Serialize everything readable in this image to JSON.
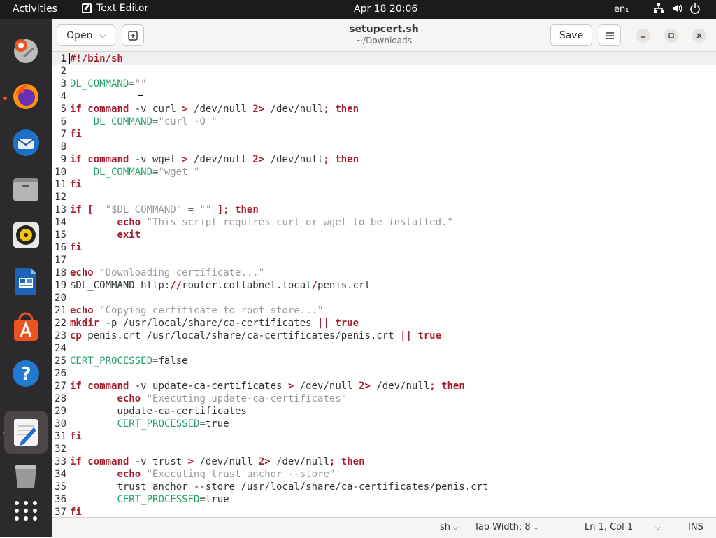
{
  "topbar": {
    "activities": "Activities",
    "app_name": "Text Editor",
    "clock": "Apr 18  20:06",
    "language": "en₁"
  },
  "dock": {
    "items": [
      "ubuntu-dock",
      "firefox",
      "thunderbird",
      "files",
      "rhythmbox",
      "libreoffice-writer",
      "app-center",
      "help",
      "text-editor",
      "trash",
      "show-apps"
    ]
  },
  "header": {
    "open_label": "Open",
    "filename": "setupcert.sh",
    "path": "~/Downloads",
    "save_label": "Save"
  },
  "editor": {
    "lines": [
      [
        {
          "t": "#!/bin/sh",
          "c": "kw"
        }
      ],
      [],
      [
        {
          "t": "DL_COMMAND",
          "c": "var"
        },
        {
          "t": "=",
          "c": ""
        },
        {
          "t": "\"\"",
          "c": "str"
        }
      ],
      [],
      [
        {
          "t": "if",
          "c": "kw"
        },
        {
          "t": " ",
          "c": ""
        },
        {
          "t": "command",
          "c": "kw"
        },
        {
          "t": " -v curl ",
          "c": ""
        },
        {
          "t": ">",
          "c": "kw"
        },
        {
          "t": " /dev/null ",
          "c": ""
        },
        {
          "t": "2>",
          "c": "kw"
        },
        {
          "t": " /dev/null",
          "c": ""
        },
        {
          "t": ";",
          "c": "kw"
        },
        {
          "t": " ",
          "c": ""
        },
        {
          "t": "then",
          "c": "kw"
        }
      ],
      [
        {
          "t": "    ",
          "c": ""
        },
        {
          "t": "DL_COMMAND",
          "c": "var"
        },
        {
          "t": "=",
          "c": ""
        },
        {
          "t": "\"curl -O \"",
          "c": "str"
        }
      ],
      [
        {
          "t": "fi",
          "c": "kw"
        }
      ],
      [],
      [
        {
          "t": "if",
          "c": "kw"
        },
        {
          "t": " ",
          "c": ""
        },
        {
          "t": "command",
          "c": "kw"
        },
        {
          "t": " -v wget ",
          "c": ""
        },
        {
          "t": ">",
          "c": "kw"
        },
        {
          "t": " /dev/null ",
          "c": ""
        },
        {
          "t": "2>",
          "c": "kw"
        },
        {
          "t": " /dev/null",
          "c": ""
        },
        {
          "t": ";",
          "c": "kw"
        },
        {
          "t": " ",
          "c": ""
        },
        {
          "t": "then",
          "c": "kw"
        }
      ],
      [
        {
          "t": "    ",
          "c": ""
        },
        {
          "t": "DL_COMMAND",
          "c": "var"
        },
        {
          "t": "=",
          "c": ""
        },
        {
          "t": "\"wget \"",
          "c": "str"
        }
      ],
      [
        {
          "t": "fi",
          "c": "kw"
        }
      ],
      [],
      [
        {
          "t": "if",
          "c": "kw"
        },
        {
          "t": " ",
          "c": ""
        },
        {
          "t": "[",
          "c": "kw"
        },
        {
          "t": "  ",
          "c": ""
        },
        {
          "t": "\"$DL_COMMAND\"",
          "c": "str"
        },
        {
          "t": " = ",
          "c": ""
        },
        {
          "t": "\"\"",
          "c": "str"
        },
        {
          "t": " ",
          "c": ""
        },
        {
          "t": "];",
          "c": "kw"
        },
        {
          "t": " ",
          "c": ""
        },
        {
          "t": "then",
          "c": "kw"
        }
      ],
      [
        {
          "t": "        ",
          "c": ""
        },
        {
          "t": "echo",
          "c": "kw"
        },
        {
          "t": " ",
          "c": ""
        },
        {
          "t": "\"This script requires curl or wget to be installed.\"",
          "c": "str"
        }
      ],
      [
        {
          "t": "        ",
          "c": ""
        },
        {
          "t": "exit",
          "c": "kw"
        }
      ],
      [
        {
          "t": "fi",
          "c": "kw"
        }
      ],
      [],
      [
        {
          "t": "echo",
          "c": "kw"
        },
        {
          "t": " ",
          "c": ""
        },
        {
          "t": "\"Downloading certificate...\"",
          "c": "str"
        }
      ],
      [
        {
          "t": "$DL_COMMAND",
          "c": ""
        },
        {
          "t": " http:",
          "c": ""
        },
        {
          "t": "//",
          "c": "kw"
        },
        {
          "t": "router.collabnet.local",
          "c": ""
        },
        {
          "t": "/",
          "c": "kw"
        },
        {
          "t": "penis.crt",
          "c": ""
        }
      ],
      [],
      [
        {
          "t": "echo",
          "c": "kw"
        },
        {
          "t": " ",
          "c": ""
        },
        {
          "t": "\"Copying certificate to root store...\"",
          "c": "str"
        }
      ],
      [
        {
          "t": "mkdir",
          "c": "kw"
        },
        {
          "t": " -p /usr/local/share/ca-certificates ",
          "c": ""
        },
        {
          "t": "||",
          "c": "kw"
        },
        {
          "t": " ",
          "c": ""
        },
        {
          "t": "true",
          "c": "kw"
        }
      ],
      [
        {
          "t": "cp",
          "c": "kw"
        },
        {
          "t": " penis.crt /usr/local/share/ca-certificates/penis.crt ",
          "c": ""
        },
        {
          "t": "||",
          "c": "kw"
        },
        {
          "t": " ",
          "c": ""
        },
        {
          "t": "true",
          "c": "kw"
        }
      ],
      [],
      [
        {
          "t": "CERT_PROCESSED",
          "c": "var"
        },
        {
          "t": "=false",
          "c": ""
        }
      ],
      [],
      [
        {
          "t": "if",
          "c": "kw"
        },
        {
          "t": " ",
          "c": ""
        },
        {
          "t": "command",
          "c": "kw"
        },
        {
          "t": " -v update-ca-certificates ",
          "c": ""
        },
        {
          "t": ">",
          "c": "kw"
        },
        {
          "t": " /dev/null ",
          "c": ""
        },
        {
          "t": "2>",
          "c": "kw"
        },
        {
          "t": " /dev/null",
          "c": ""
        },
        {
          "t": ";",
          "c": "kw"
        },
        {
          "t": " ",
          "c": ""
        },
        {
          "t": "then",
          "c": "kw"
        }
      ],
      [
        {
          "t": "        ",
          "c": ""
        },
        {
          "t": "echo",
          "c": "kw"
        },
        {
          "t": " ",
          "c": ""
        },
        {
          "t": "\"Executing update-ca-certificates\"",
          "c": "str"
        }
      ],
      [
        {
          "t": "        update-ca-certificates",
          "c": ""
        }
      ],
      [
        {
          "t": "        ",
          "c": ""
        },
        {
          "t": "CERT_PROCESSED",
          "c": "var"
        },
        {
          "t": "=true",
          "c": ""
        }
      ],
      [
        {
          "t": "fi",
          "c": "kw"
        }
      ],
      [],
      [
        {
          "t": "if",
          "c": "kw"
        },
        {
          "t": " ",
          "c": ""
        },
        {
          "t": "command",
          "c": "kw"
        },
        {
          "t": " -v trust ",
          "c": ""
        },
        {
          "t": ">",
          "c": "kw"
        },
        {
          "t": " /dev/null ",
          "c": ""
        },
        {
          "t": "2>",
          "c": "kw"
        },
        {
          "t": " /dev/null",
          "c": ""
        },
        {
          "t": ";",
          "c": "kw"
        },
        {
          "t": " ",
          "c": ""
        },
        {
          "t": "then",
          "c": "kw"
        }
      ],
      [
        {
          "t": "        ",
          "c": ""
        },
        {
          "t": "echo",
          "c": "kw"
        },
        {
          "t": " ",
          "c": ""
        },
        {
          "t": "\"Executing trust anchor --store\"",
          "c": "str"
        }
      ],
      [
        {
          "t": "        trust anchor --store /usr/local/share/ca-certificates/penis.crt",
          "c": ""
        }
      ],
      [
        {
          "t": "        ",
          "c": ""
        },
        {
          "t": "CERT_PROCESSED",
          "c": "var"
        },
        {
          "t": "=true",
          "c": ""
        }
      ],
      [
        {
          "t": "fi",
          "c": "kw"
        }
      ]
    ]
  },
  "status": {
    "language": "sh",
    "tab_width": "Tab Width: 8",
    "position": "Ln 1, Col 1",
    "mode": "INS"
  },
  "colors": {
    "keyword": "#a51d2d",
    "variable": "#26a269",
    "string": "#9a9996",
    "accent": "#e95420"
  }
}
